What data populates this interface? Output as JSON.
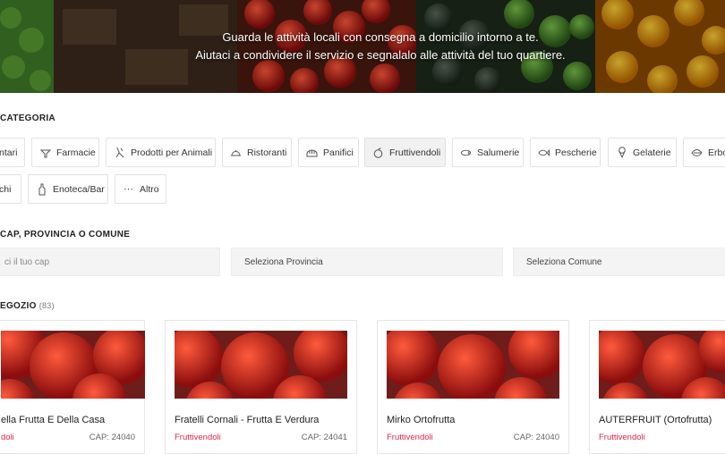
{
  "hero": {
    "line1": "Guarda le attività locali con consegna a domicilio intorno a te.",
    "line2": "Aiutaci a condividere il servizio e segnalalo alle attività del tuo quartiere."
  },
  "category_section": {
    "title": "CATEGORIA",
    "chips_row1": [
      {
        "label": "ntari",
        "icon": "food-icon"
      },
      {
        "label": "Farmacie",
        "icon": "mortar-icon"
      },
      {
        "label": "Prodotti per Animali",
        "icon": "pet-icon"
      },
      {
        "label": "Ristoranti",
        "icon": "cloche-icon"
      },
      {
        "label": "Panifici",
        "icon": "bread-icon"
      },
      {
        "label": "Fruttivendoli",
        "icon": "fruit-icon",
        "active": true
      },
      {
        "label": "Salumerie",
        "icon": "salami-icon"
      },
      {
        "label": "Pescherie",
        "icon": "fish-icon"
      },
      {
        "label": "Gelaterie",
        "icon": "icecream-icon"
      },
      {
        "label": "Erbo",
        "icon": "leaf-icon"
      }
    ],
    "chips_row2": [
      {
        "label": "chi",
        "icon": ""
      },
      {
        "label": "Enoteca/Bar",
        "icon": "bottle-icon"
      },
      {
        "label": "Altro",
        "icon": "more-icon"
      }
    ]
  },
  "location_section": {
    "title": "CAP, PROVINCIA O COMUNE",
    "cap_placeholder": "ci il tuo cap",
    "provincia_label": "Seleziona Provincia",
    "comune_label": "Seleziona Comune"
  },
  "shop_section": {
    "title": "EGOZIO",
    "count": "(83)",
    "cards": [
      {
        "name": "ella Frutta E Della Casa",
        "category": "doli",
        "cap": "CAP: 24040"
      },
      {
        "name": "Fratelli Cornali - Frutta E Verdura",
        "category": "Fruttivendoli",
        "cap": "CAP: 24041"
      },
      {
        "name": "Mirko Ortofrutta",
        "category": "Fruttivendoli",
        "cap": "CAP: 24040"
      },
      {
        "name": "AUTERFRUIT (Ortofrutta)",
        "category": "Fruttivendoli",
        "cap": ""
      }
    ]
  },
  "colors": {
    "accent": "#e2264d",
    "chip_border": "#e3e3e3",
    "field_bg": "#f4f4f4"
  }
}
